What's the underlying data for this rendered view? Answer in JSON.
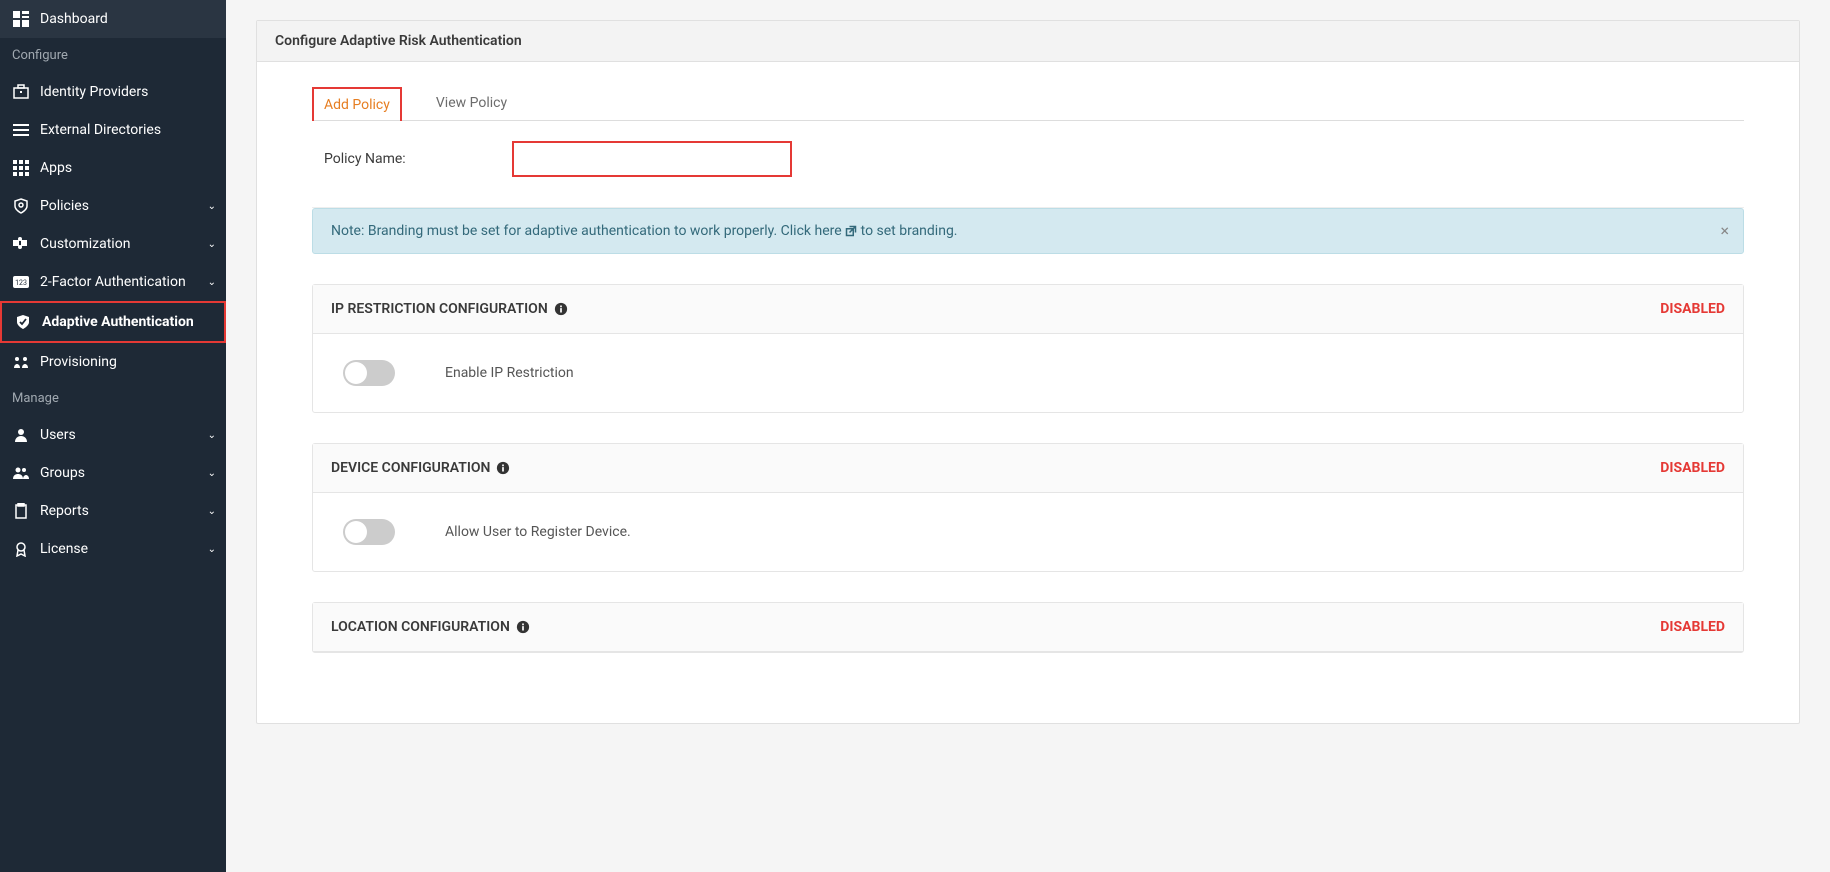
{
  "sidebar": {
    "items": {
      "dashboard": "Dashboard",
      "identity_providers": "Identity Providers",
      "external_directories": "External Directories",
      "apps": "Apps",
      "policies": "Policies",
      "customization": "Customization",
      "two_factor": "2-Factor Authentication",
      "adaptive_auth": "Adaptive Authentication",
      "provisioning": "Provisioning",
      "users": "Users",
      "groups": "Groups",
      "reports": "Reports",
      "license": "License"
    },
    "sections": {
      "configure": "Configure",
      "manage": "Manage"
    }
  },
  "header": {
    "title": "Configure Adaptive Risk Authentication"
  },
  "tabs": {
    "add_policy": "Add Policy",
    "view_policy": "View Policy"
  },
  "form": {
    "policy_name_label": "Policy Name:"
  },
  "alert": {
    "note_label": "Note:",
    "text_before_link": " Branding must be set for adaptive authentication to work properly. Click ",
    "link_text": "here",
    "text_after_link": " to set branding."
  },
  "sections": {
    "ip_restriction": {
      "title": "IP RESTRICTION CONFIGURATION",
      "status": "DISABLED",
      "toggle_label": "Enable IP Restriction"
    },
    "device": {
      "title": "DEVICE CONFIGURATION",
      "status": "DISABLED",
      "toggle_label": "Allow User to Register Device."
    },
    "location": {
      "title": "LOCATION CONFIGURATION",
      "status": "DISABLED"
    }
  }
}
